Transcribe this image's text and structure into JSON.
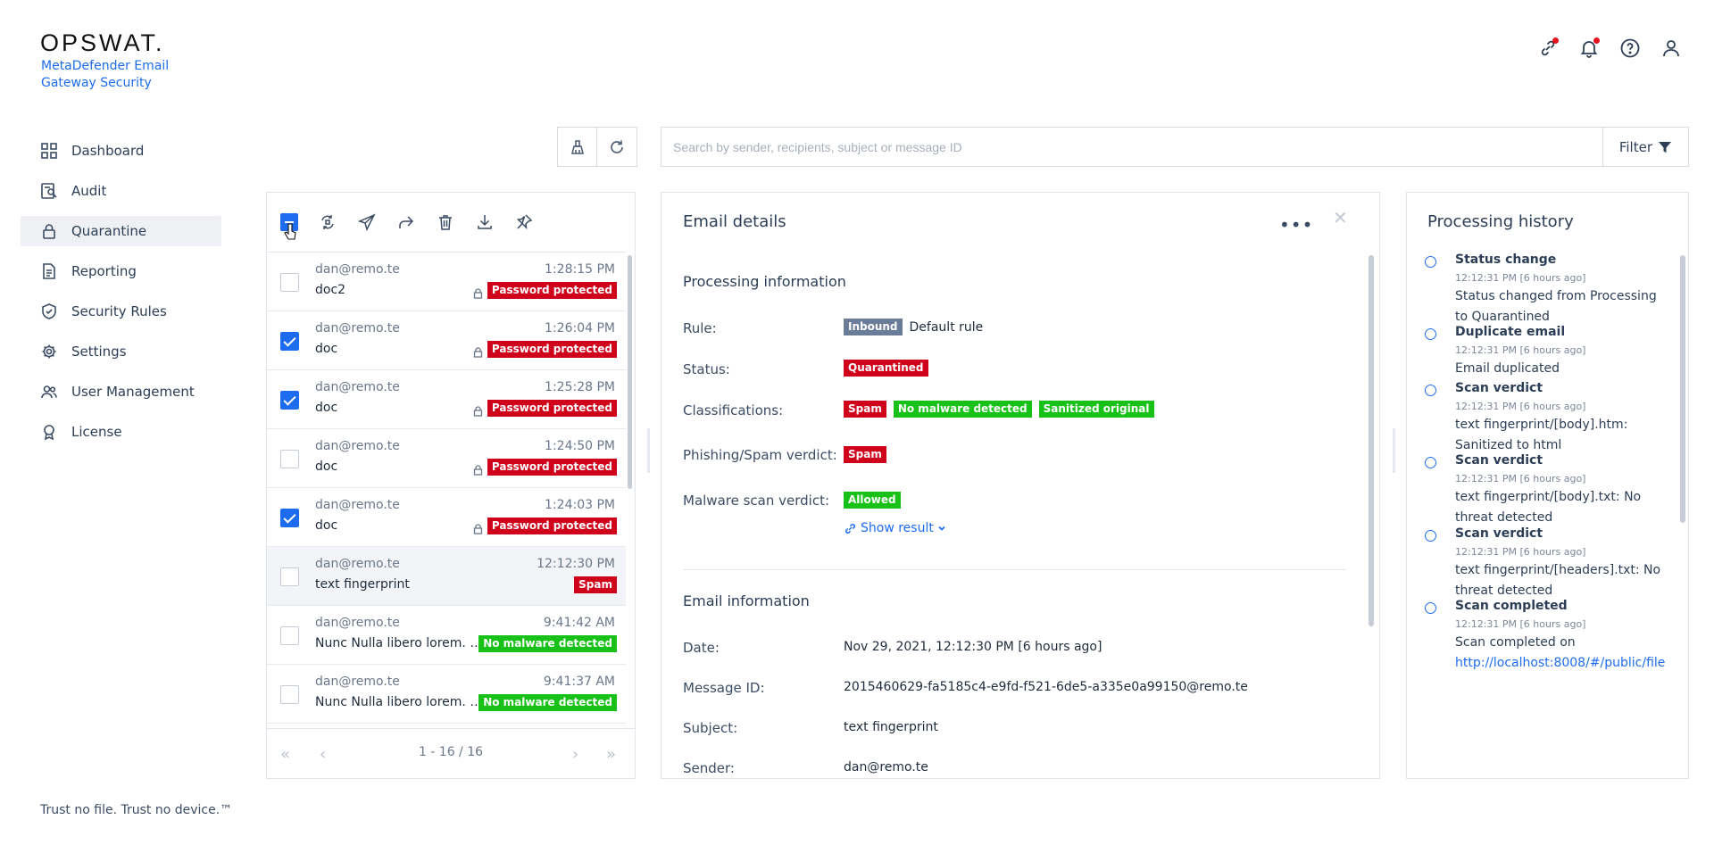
{
  "brand": {
    "logo": "OPSWAT.",
    "product": "MetaDefender Email Gateway Security",
    "tagline": "Trust no file. Trust no device.™"
  },
  "header_icons": [
    "link-icon",
    "bell-icon",
    "help-icon",
    "user-icon"
  ],
  "sidebar": {
    "items": [
      {
        "label": "Dashboard",
        "icon": "dashboard-icon"
      },
      {
        "label": "Audit",
        "icon": "audit-icon"
      },
      {
        "label": "Quarantine",
        "icon": "lock-icon",
        "active": true
      },
      {
        "label": "Reporting",
        "icon": "report-icon"
      },
      {
        "label": "Security Rules",
        "icon": "shield-check-icon"
      },
      {
        "label": "Settings",
        "icon": "gear-icon"
      },
      {
        "label": "User Management",
        "icon": "users-icon"
      },
      {
        "label": "License",
        "icon": "award-icon"
      }
    ]
  },
  "search": {
    "placeholder": "Search by sender, recipients, subject or message ID",
    "filter_label": "Filter"
  },
  "list": {
    "rows": [
      {
        "from": "dan@remo.te",
        "time": "1:28:15 PM",
        "subject": "doc2",
        "badge": "Password protected",
        "badge_color": "#d0021b",
        "locked": true,
        "checked": false,
        "selected": false
      },
      {
        "from": "dan@remo.te",
        "time": "1:26:04 PM",
        "subject": "doc",
        "badge": "Password protected",
        "badge_color": "#d0021b",
        "locked": true,
        "checked": true,
        "selected": false
      },
      {
        "from": "dan@remo.te",
        "time": "1:25:28 PM",
        "subject": "doc",
        "badge": "Password protected",
        "badge_color": "#d0021b",
        "locked": true,
        "checked": true,
        "selected": false
      },
      {
        "from": "dan@remo.te",
        "time": "1:24:50 PM",
        "subject": "doc",
        "badge": "Password protected",
        "badge_color": "#d0021b",
        "locked": true,
        "checked": false,
        "selected": false
      },
      {
        "from": "dan@remo.te",
        "time": "1:24:03 PM",
        "subject": "doc",
        "badge": "Password protected",
        "badge_color": "#d0021b",
        "locked": true,
        "checked": true,
        "selected": false
      },
      {
        "from": "dan@remo.te",
        "time": "12:12:30 PM",
        "subject": "text fingerprint",
        "badge": "Spam",
        "badge_color": "#d0021b",
        "locked": false,
        "checked": false,
        "selected": true
      },
      {
        "from": "dan@remo.te",
        "time": "9:41:42 AM",
        "subject": "Nunc Nulla libero lorem. n...",
        "badge": "No malware detected",
        "badge_color": "#17c117",
        "locked": false,
        "checked": false,
        "selected": false
      },
      {
        "from": "dan@remo.te",
        "time": "9:41:37 AM",
        "subject": "Nunc Nulla libero lorem. n...",
        "badge": "No malware detected",
        "badge_color": "#17c117",
        "locked": false,
        "checked": false,
        "selected": false
      }
    ],
    "pager_text": "1 - 16 / 16"
  },
  "details": {
    "title": "Email details",
    "processing_title": "Processing information",
    "rule_label": "Rule:",
    "rule_badge": "Inbound",
    "rule_value": "Default rule",
    "status_label": "Status:",
    "status_badge": "Quarantined",
    "classifications_label": "Classifications:",
    "classifications": [
      "Spam",
      "No malware detected",
      "Sanitized original"
    ],
    "phishing_label": "Phishing/Spam verdict:",
    "phishing_badge": "Spam",
    "malware_label": "Malware scan verdict:",
    "malware_badge": "Allowed",
    "show_result": "Show result",
    "email_info_title": "Email information",
    "date_label": "Date:",
    "date_value": "Nov 29, 2021, 12:12:30 PM [6 hours ago]",
    "msgid_label": "Message ID:",
    "msgid_value": "2015460629-fa5185c4-e9fd-f521-6de5-a335e0a99150@remo.te",
    "subject_label": "Subject:",
    "subject_value": "text fingerprint",
    "sender_label": "Sender:",
    "sender_value": "dan@remo.te"
  },
  "history": {
    "title": "Processing history",
    "items": [
      {
        "title": "Status change",
        "time": "12:12:31 PM [6 hours ago]",
        "desc": "Status changed from Processing to Quarantined"
      },
      {
        "title": "Duplicate email",
        "time": "12:12:31 PM [6 hours ago]",
        "desc": "Email duplicated"
      },
      {
        "title": "Scan verdict",
        "time": "12:12:31 PM [6 hours ago]",
        "desc": "text fingerprint/[body].htm: Sanitized to html"
      },
      {
        "title": "Scan verdict",
        "time": "12:12:31 PM [6 hours ago]",
        "desc": "text fingerprint/[body].txt: No threat detected"
      },
      {
        "title": "Scan verdict",
        "time": "12:12:31 PM [6 hours ago]",
        "desc": "text fingerprint/[headers].txt: No threat detected"
      },
      {
        "title": "Scan completed",
        "time": "12:12:31 PM [6 hours ago]",
        "desc": "Scan completed on",
        "link": "http://localhost:8008/#/public/file"
      }
    ]
  }
}
